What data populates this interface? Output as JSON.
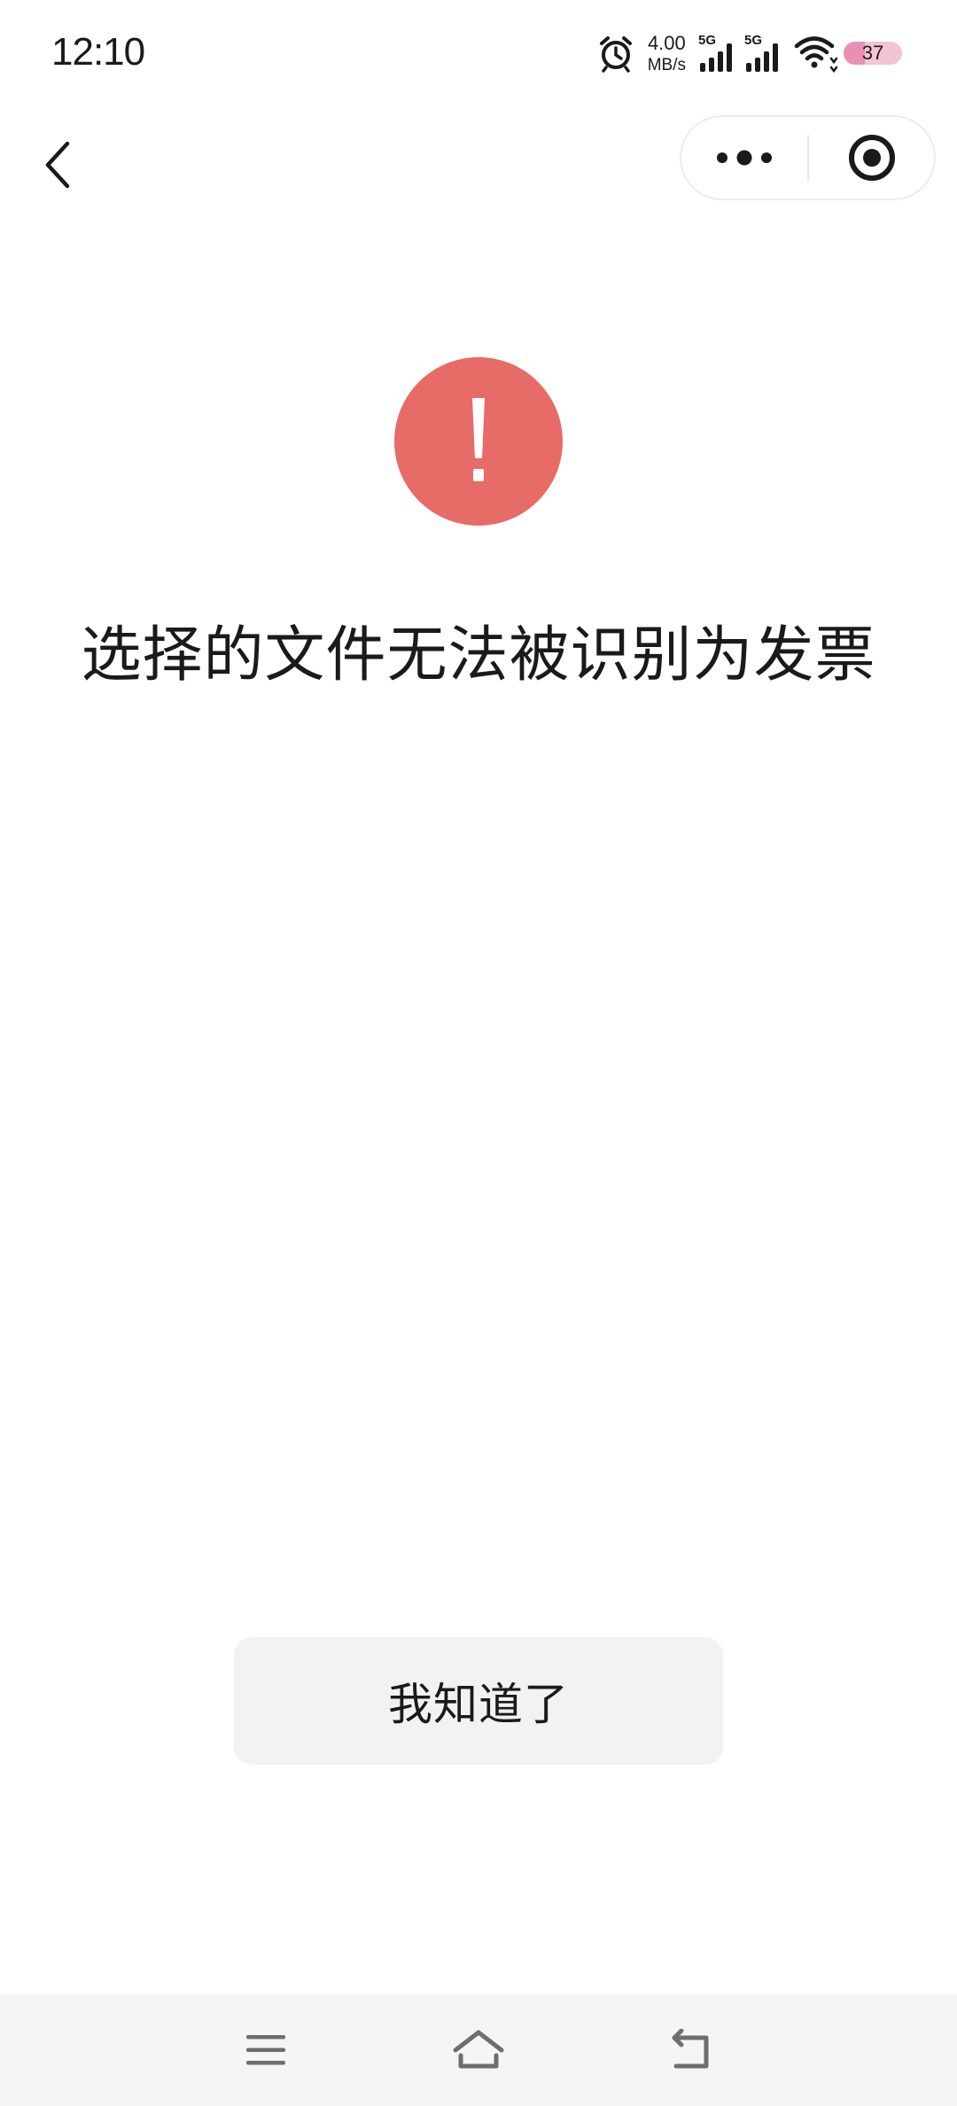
{
  "status_bar": {
    "time": "12:10",
    "net_speed_value": "4.00",
    "net_speed_unit": "MB/s",
    "sim1_label": "5G",
    "sim2_label": "5G",
    "battery_level": "37",
    "battery_fraction": 0.37,
    "icons": [
      "alarm-icon",
      "signal-icon",
      "signal-icon",
      "wifi-icon",
      "battery-icon"
    ]
  },
  "header": {
    "back_icon": "chevron-left-icon",
    "more_icon": "more-dots-icon",
    "close_icon": "target-close-icon"
  },
  "main": {
    "icon": "exclamation-icon",
    "icon_color": "#e76b66",
    "message": "选择的文件无法被识别为发票",
    "confirm_label": "我知道了"
  },
  "nav_bar": {
    "icons": [
      "menu-icon",
      "home-icon",
      "back-icon"
    ]
  }
}
